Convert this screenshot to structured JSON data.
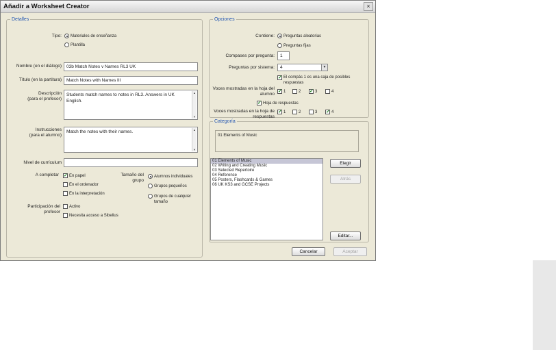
{
  "window": {
    "title": "Añadir a Worksheet Creator",
    "close_glyph": "×"
  },
  "details": {
    "legend": "Detalles",
    "type_label": "Tipo:",
    "type_options": [
      "Materiales de enseñanza",
      "Plantilla"
    ],
    "name_label": "Nombre (en el diálogo)",
    "name_value": "03b Match Notes v Names RL3 UK",
    "title_label": "Título (en la partitura)",
    "title_value": "Match Notes with Names III",
    "desc_label_1": "Descripción",
    "desc_label_2": "(para el profesor)",
    "desc_value": "Students match names to notes in RL3. Answers in UK English.",
    "instr_label_1": "Instrucciones",
    "instr_label_2": "(para el alumno)",
    "instr_value": "Match the notes with their names.",
    "curriculum_label": "Nivel de currículum",
    "curriculum_value": "",
    "complete_label": "A completar",
    "complete_options": [
      "En papel",
      "En el ordenador",
      "En la interpretación"
    ],
    "group_label_1": "Tamaño del",
    "group_label_2": "grupo",
    "group_options": [
      "Alumnos individuales",
      "Grupos pequeños",
      "Grupos de cualquier tamaño"
    ],
    "teacher_label_1": "Participación del",
    "teacher_label_2": "profesor",
    "teacher_options": [
      "Activo",
      "Necesita acceso a Sibelius"
    ]
  },
  "options": {
    "legend": "Opciones",
    "contains_label": "Contiene:",
    "contains_options": [
      "Preguntas aleatorias",
      "Preguntas fijas"
    ],
    "bars_label": "Compases por pregunta:",
    "bars_value": "1",
    "questions_label": "Preguntas por sistema:",
    "questions_value": "4",
    "bar1_text": "El compás 1 es una caja de posibles respuestas",
    "student_voices_label": "Voces mostradas en la hoja del alumno",
    "answer_sheet_label": "Hoja de respuestas",
    "answer_voices_label": "Voces mostradas en la hoja de respuestas",
    "voice_numbers": [
      "1",
      "2",
      "3",
      "4"
    ]
  },
  "category": {
    "legend": "Categoría",
    "current": "01 Elements of Music",
    "items": [
      "01 Elements of Music",
      "02 Writing and Creating Music",
      "03 Selected Repertoire",
      "04 Reference",
      "05 Posters, Flashcards & Games",
      "06 UK KS3 and GCSE Projects"
    ],
    "choose_button": "Elegir",
    "back_button": "Atrás",
    "edit_button": "Editar..."
  },
  "footer": {
    "cancel_button": "Cancelar",
    "accept_button": "Aceptar"
  },
  "colors": {
    "dialog_bg": "#ece9d8",
    "legend_blue": "#2356b2",
    "check_green": "#1b7d1b"
  }
}
